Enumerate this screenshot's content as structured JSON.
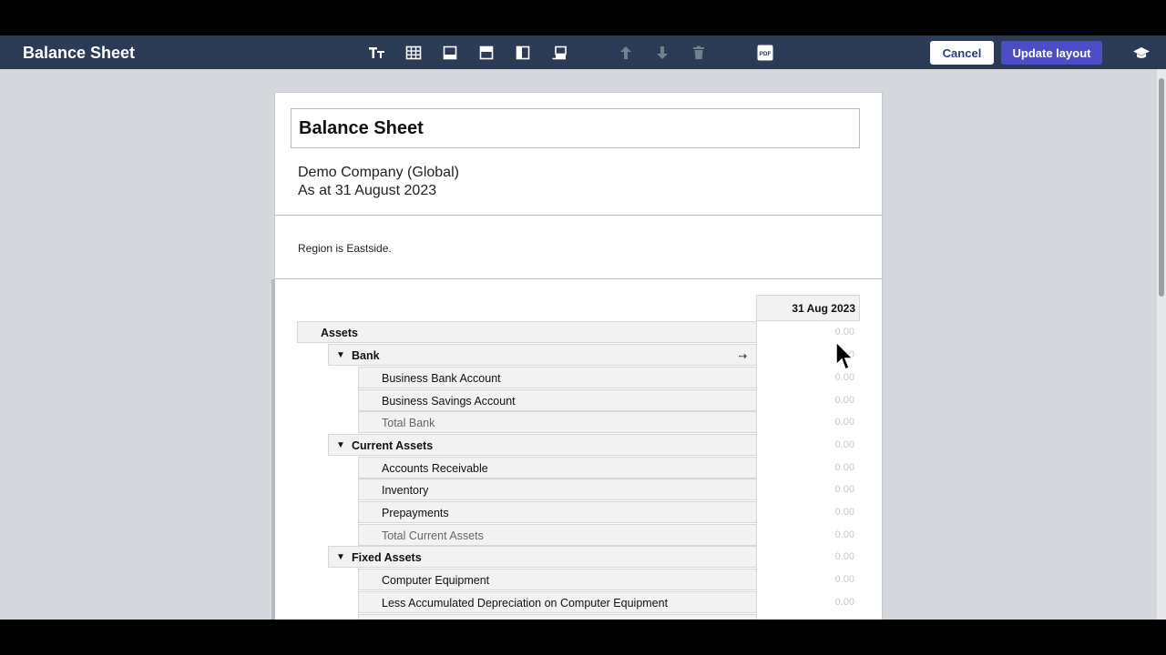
{
  "toolbar": {
    "title": "Balance Sheet",
    "cancel_label": "Cancel",
    "update_label": "Update layout",
    "pdf_label": "PDF"
  },
  "report": {
    "title_value": "Balance Sheet",
    "company": "Demo Company (Global)",
    "date_line": "As at 31 August 2023",
    "filter_text": "Region is Eastside.",
    "column_header": "31 Aug 2023"
  },
  "rows": [
    {
      "label": "Assets",
      "value": "0.00"
    },
    {
      "label": "Bank",
      "value": "0.00"
    },
    {
      "label": "Business Bank Account",
      "value": "0.00"
    },
    {
      "label": "Business Savings Account",
      "value": "0.00"
    },
    {
      "label": "Total Bank",
      "value": "0.00"
    },
    {
      "label": "Current Assets",
      "value": "0.00"
    },
    {
      "label": "Accounts Receivable",
      "value": "0.00"
    },
    {
      "label": "Inventory",
      "value": "0.00"
    },
    {
      "label": "Prepayments",
      "value": "0.00"
    },
    {
      "label": "Total Current Assets",
      "value": "0.00"
    },
    {
      "label": "Fixed Assets",
      "value": "0.00"
    },
    {
      "label": "Computer Equipment",
      "value": "0.00"
    },
    {
      "label": "Less Accumulated Depreciation on Computer Equipment",
      "value": "0.00"
    }
  ],
  "colors": {
    "toolbar_bg": "#2c3b55",
    "primary_button": "#4d4dc7",
    "canvas_bg": "#d4d8dc",
    "row_bg": "#f2f2f2"
  }
}
